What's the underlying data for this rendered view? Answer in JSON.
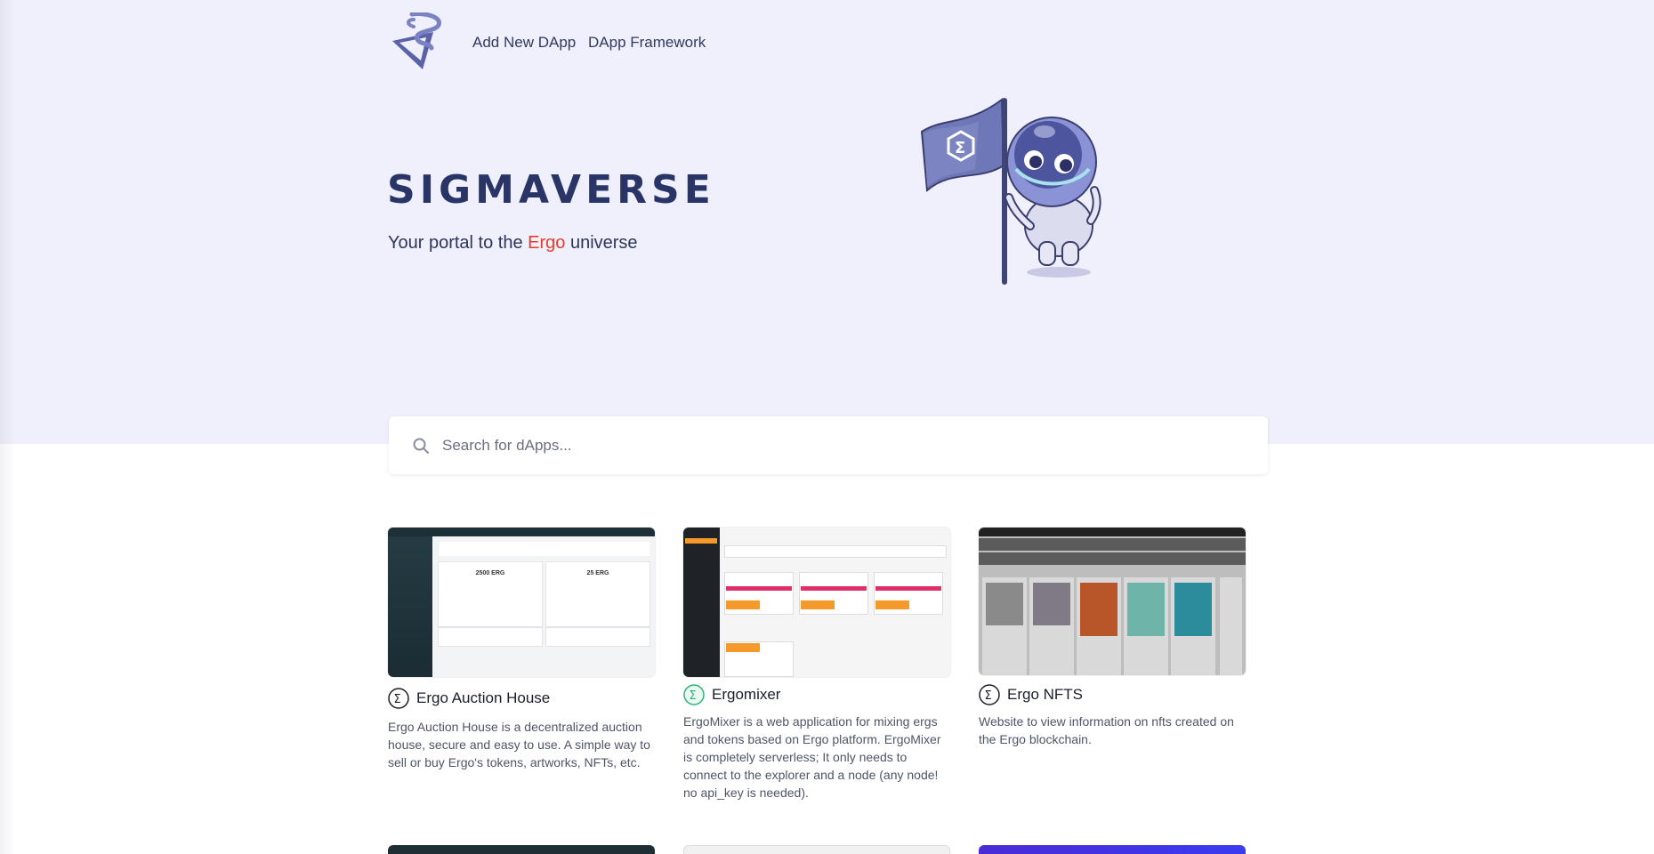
{
  "nav": {
    "logo_icon": "sigmaverse-logo",
    "links": [
      "Add New DApp",
      "DApp Framework"
    ]
  },
  "hero": {
    "title": "SIGMAVERSE",
    "subtitle_before": "Your portal to the ",
    "subtitle_accent": "Ergo",
    "subtitle_after": " universe",
    "mascot_icon": "astronaut-flag-mascot"
  },
  "search": {
    "placeholder": "Search for dApps...",
    "value": ""
  },
  "cards": [
    {
      "title": "Ergo Auction House",
      "description": "Ergo Auction House is a decentralized auction house, secure and easy to use. A simple way to sell or buy Ergo's tokens, artworks, NFTs, etc.",
      "icon": "sigma-icon",
      "thumb": {
        "price_left": "2500 ERG",
        "price_right": "25 ERG"
      }
    },
    {
      "title": "Ergomixer",
      "description": "ErgoMixer is a web application for mixing ergs and tokens based on Ergo platform. ErgoMixer is completely serverless; It only needs to connect to the explorer and a node (any node! no api_key is needed).",
      "icon": "sigma-green-icon",
      "thumb": {}
    },
    {
      "title": "Ergo NFTS",
      "description": "Website to view information on nfts created on the Ergo blockchain.",
      "icon": "sigma-icon",
      "thumb": {}
    }
  ],
  "colors": {
    "hero_bg": "#f0f0fc",
    "title": "#283566",
    "accent": "#e83b2c"
  }
}
